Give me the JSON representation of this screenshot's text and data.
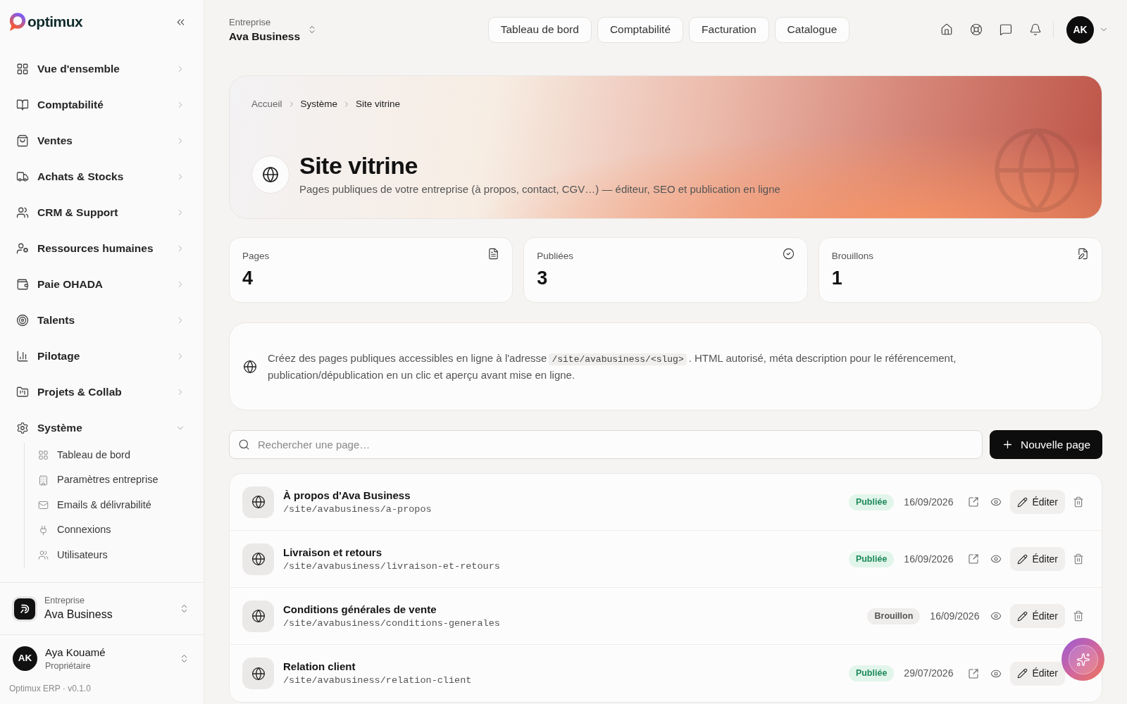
{
  "sidebar": {
    "brand": "optimux",
    "items": [
      {
        "label": "Vue d'ensemble",
        "expanded": false
      },
      {
        "label": "Comptabilité",
        "expanded": false
      },
      {
        "label": "Ventes",
        "expanded": false
      },
      {
        "label": "Achats & Stocks",
        "expanded": false
      },
      {
        "label": "CRM & Support",
        "expanded": false
      },
      {
        "label": "Ressources humaines",
        "expanded": false
      },
      {
        "label": "Paie OHADA",
        "expanded": false
      },
      {
        "label": "Talents",
        "expanded": false
      },
      {
        "label": "Pilotage",
        "expanded": false
      },
      {
        "label": "Projets & Collab",
        "expanded": false
      },
      {
        "label": "Système",
        "expanded": true,
        "children": [
          {
            "label": "Tableau de bord"
          },
          {
            "label": "Paramètres entreprise"
          },
          {
            "label": "Emails & délivrabilité"
          },
          {
            "label": "Connexions"
          },
          {
            "label": "Utilisateurs"
          }
        ]
      }
    ],
    "company": {
      "caption": "Entreprise",
      "name": "Ava Business"
    },
    "user": {
      "initials": "AK",
      "name": "Aya Kouamé",
      "role": "Propriétaire"
    },
    "version": "Optimux ERP · v0.1.0"
  },
  "topbar": {
    "company": {
      "caption": "Entreprise",
      "name": "Ava Business"
    },
    "links": [
      "Tableau de bord",
      "Comptabilité",
      "Facturation",
      "Catalogue"
    ],
    "avatar": "AK"
  },
  "hero": {
    "breadcrumb": [
      "Accueil",
      "Système",
      "Site vitrine"
    ],
    "title": "Site vitrine",
    "subtitle": "Pages publiques de votre entreprise (à propos, contact, CGV…) — éditeur, SEO et publication en ligne"
  },
  "stats": [
    {
      "label": "Pages",
      "value": "4"
    },
    {
      "label": "Publiées",
      "value": "3"
    },
    {
      "label": "Brouillons",
      "value": "1"
    }
  ],
  "info": {
    "parts": [
      {
        "kind": "text",
        "text": "Créez des pages publiques accessibles en ligne à l'adresse"
      },
      {
        "kind": "code",
        "text": "/site/avabusiness/<slug>"
      },
      {
        "kind": "text",
        "text": ". HTML autorisé, méta description pour le référencement, publication/dépublication en un clic et aperçu avant mise en ligne."
      }
    ]
  },
  "search": {
    "placeholder": "Rechercher une page…"
  },
  "new_page_button": "Nouvelle page",
  "pages": [
    {
      "title": "À propos d'Ava Business",
      "path": "/site/avabusiness/a-propos",
      "status": {
        "kind": "published",
        "label": "Publiée"
      },
      "date": "16/09/2026",
      "actions": [
        {
          "kind": "open"
        },
        {
          "kind": "preview"
        },
        {
          "kind": "edit",
          "label": "Éditer"
        },
        {
          "kind": "delete"
        }
      ]
    },
    {
      "title": "Livraison et retours",
      "path": "/site/avabusiness/livraison-et-retours",
      "status": {
        "kind": "published",
        "label": "Publiée"
      },
      "date": "16/09/2026",
      "actions": [
        {
          "kind": "open"
        },
        {
          "kind": "preview"
        },
        {
          "kind": "edit",
          "label": "Éditer"
        },
        {
          "kind": "delete"
        }
      ]
    },
    {
      "title": "Conditions générales de vente",
      "path": "/site/avabusiness/conditions-generales",
      "status": {
        "kind": "draft",
        "label": "Brouillon"
      },
      "date": "16/09/2026",
      "actions": [
        {
          "kind": "preview"
        },
        {
          "kind": "edit",
          "label": "Éditer"
        },
        {
          "kind": "delete"
        }
      ]
    },
    {
      "title": "Relation client",
      "path": "/site/avabusiness/relation-client",
      "status": {
        "kind": "published",
        "label": "Publiée"
      },
      "date": "29/07/2026",
      "actions": [
        {
          "kind": "open"
        },
        {
          "kind": "preview"
        },
        {
          "kind": "edit",
          "label": "Éditer"
        }
      ]
    }
  ]
}
